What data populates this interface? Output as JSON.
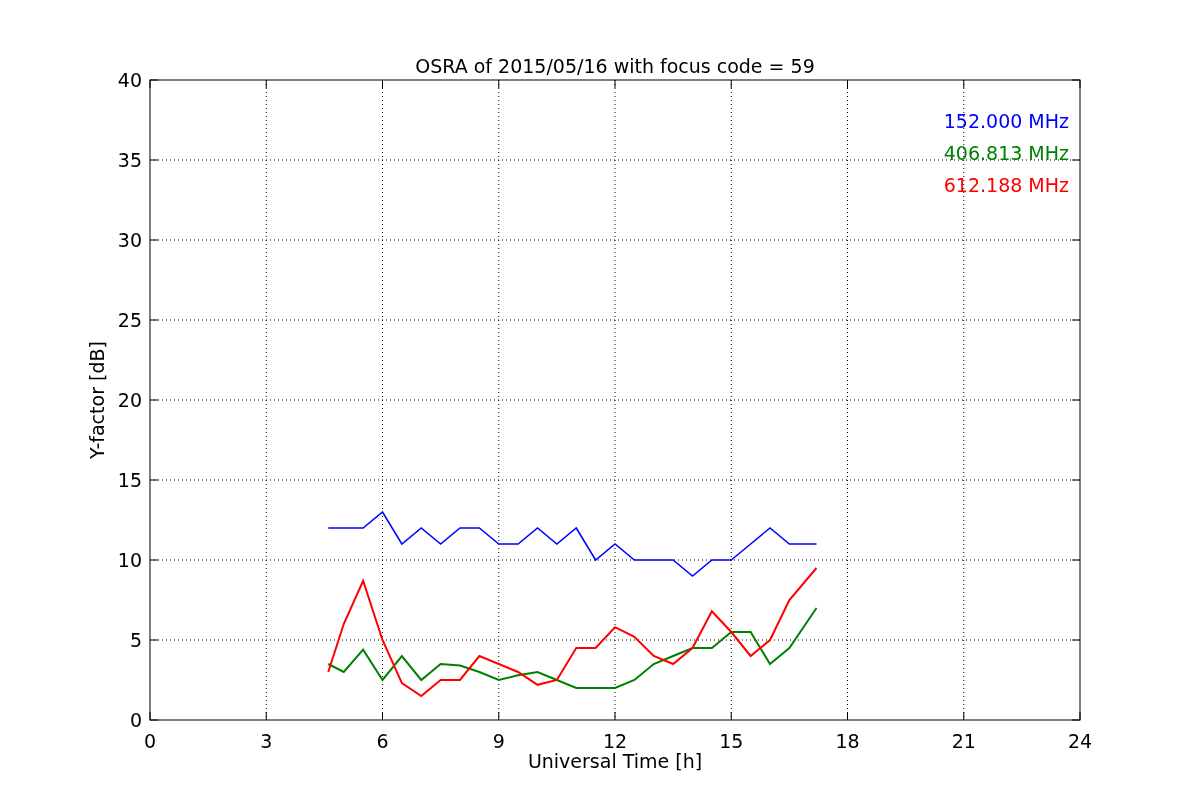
{
  "chart_data": {
    "type": "line",
    "title": "OSRA of 2015/05/16 with focus code = 59",
    "xlabel": "Universal Time [h]",
    "ylabel": "Y-factor [dB]",
    "x": [
      4.6,
      5,
      5.5,
      6,
      6.5,
      7,
      7.5,
      8,
      8.5,
      9,
      9.5,
      10,
      10.5,
      11,
      11.5,
      12,
      12.5,
      13,
      13.5,
      14,
      14.5,
      15,
      15.5,
      16,
      16.5,
      17.2
    ],
    "series": [
      {
        "name": "152.000 MHz",
        "color": "#0000ff",
        "values": [
          12,
          12,
          12,
          13,
          11,
          12,
          11,
          12,
          12,
          11,
          11,
          12,
          11,
          12,
          10,
          11,
          10,
          10,
          10,
          9,
          10,
          10,
          11,
          12,
          11,
          11
        ]
      },
      {
        "name": "406.813 MHz",
        "color": "#008000",
        "values": [
          3.5,
          3,
          4.4,
          2.5,
          4,
          2.5,
          3.5,
          3.4,
          3,
          2.5,
          2.8,
          3,
          2.5,
          2,
          2,
          2,
          2.5,
          3.5,
          4,
          4.5,
          4.5,
          5.5,
          5.5,
          3.5,
          4.5,
          7
        ]
      },
      {
        "name": "612.188 MHz",
        "color": "#ff0000",
        "values": [
          3,
          6,
          8.7,
          5,
          2.3,
          1.5,
          2.5,
          2.5,
          4,
          3.5,
          3,
          2.2,
          2.5,
          4.5,
          4.5,
          5.8,
          5.2,
          4,
          3.5,
          4.5,
          6.8,
          5.5,
          4,
          5,
          7.5,
          9.5
        ]
      }
    ],
    "grid": true,
    "xlim": [
      0,
      24
    ],
    "ylim": [
      0,
      40
    ],
    "xticks": [
      0,
      3,
      6,
      9,
      12,
      15,
      18,
      21,
      24
    ],
    "yticks": [
      0,
      5,
      10,
      15,
      20,
      25,
      30,
      35,
      40
    ]
  }
}
